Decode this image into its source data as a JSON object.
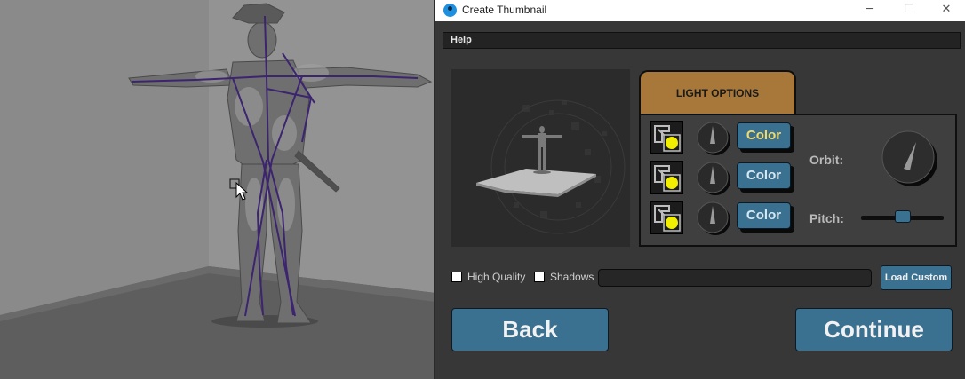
{
  "window": {
    "title": "Create Thumbnail",
    "minimize_glyph": "─",
    "maximize_glyph": "☐",
    "close_glyph": "✕"
  },
  "menubar": {
    "help": "Help"
  },
  "tabs": {
    "light_options": "LIGHT OPTIONS"
  },
  "lights": {
    "items": [
      {
        "icon": "light-bulb-icon",
        "color_label": "Color",
        "active": true
      },
      {
        "icon": "light-bulb-icon",
        "color_label": "Color",
        "active": false
      },
      {
        "icon": "light-bulb-icon",
        "color_label": "Color",
        "active": false
      }
    ],
    "orbit_label": "Orbit:",
    "pitch_label": "Pitch:",
    "pitch_value": 0.5
  },
  "options": {
    "high_quality_label": "High Quality",
    "high_quality_checked": false,
    "shadows_label": "Shadows",
    "shadows_checked": false,
    "load_custom_label": "Load Custom"
  },
  "actions": {
    "back_label": "Back",
    "continue_label": "Continue"
  },
  "colors": {
    "accent": "#3b7190",
    "tab": "#a8783a",
    "light_indicator": "#f2ee00",
    "rig_lines": "#3c2470"
  }
}
